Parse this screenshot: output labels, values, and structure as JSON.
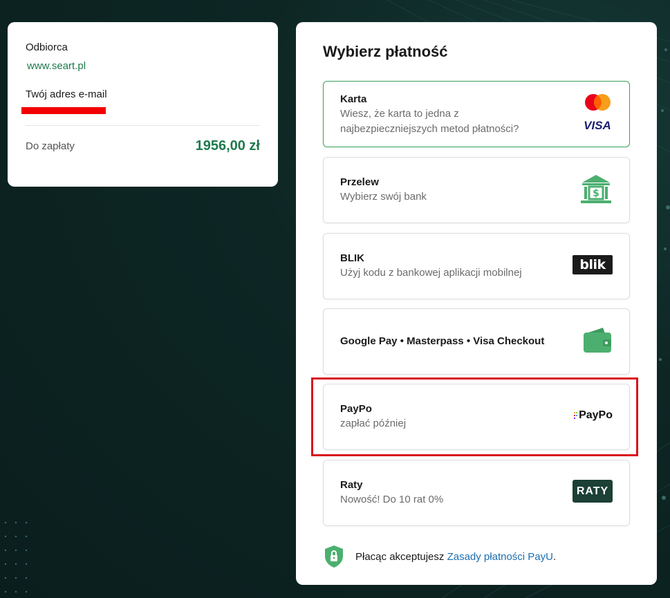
{
  "recipient": {
    "label": "Odbiorca",
    "link": "www.seart.pl"
  },
  "email": {
    "label": "Twój adres e-mail"
  },
  "payment_due": {
    "label": "Do zapłaty",
    "amount": "1956,00 zł"
  },
  "payment_panel": {
    "title": "Wybierz płatność",
    "methods": [
      {
        "title": "Karta",
        "desc1": "Wiesz, że karta to jedna z",
        "desc2": "najbezpieczniejszych metod płatności?",
        "icon": "mastercard-visa-icon",
        "visa_text": "VISA"
      },
      {
        "title": "Przelew",
        "desc1": "Wybierz swój bank",
        "icon": "bank-icon"
      },
      {
        "title": "BLIK",
        "desc1": "Użyj kodu z bankowej aplikacji mobilnej",
        "icon": "blik-logo",
        "logo_text": "blik"
      },
      {
        "title": "Google Pay • Masterpass • Visa Checkout",
        "icon": "wallet-icon"
      },
      {
        "title": "PayPo",
        "desc1": "zapłać później",
        "icon": "paypo-logo",
        "logo_text": "PayPo"
      },
      {
        "title": "Raty",
        "desc1": "Nowość! Do 10 rat 0%",
        "icon": "raty-logo",
        "logo_text": "RATY"
      }
    ],
    "footer": {
      "text": "Płacąc akceptujesz",
      "link": "Zasady płatności PayU",
      "suffix": "."
    }
  },
  "colors": {
    "accent": "#1f7a4d",
    "selected_border": "#3aa25a",
    "highlight": "#d9141b",
    "background": "#0d2624"
  }
}
